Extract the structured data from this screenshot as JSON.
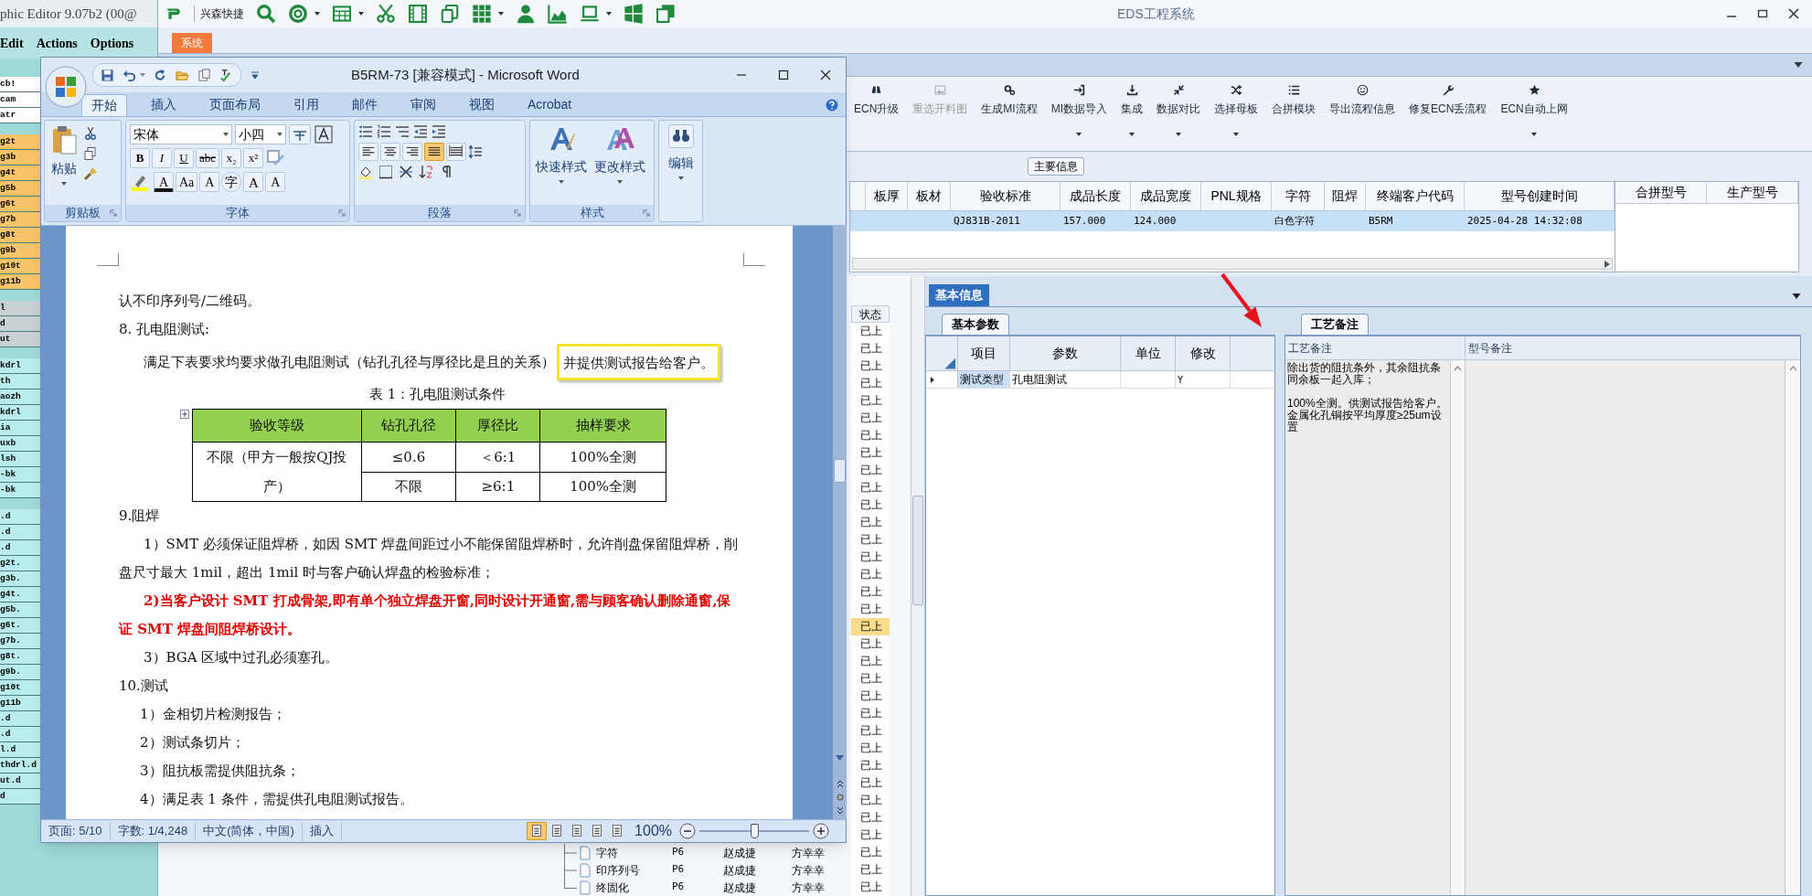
{
  "editor_app": {
    "title": "phic Editor 9.07b2 (00@",
    "menu": [
      "Edit",
      "Actions",
      "Options"
    ],
    "list_groups": [
      {
        "color": "#ffffff",
        "items": [
          "cb!",
          "cam",
          "atr"
        ]
      },
      {
        "color": "#f7c46a",
        "items": [
          "g2t",
          "g3b",
          "g4t",
          "g5b",
          "g6t",
          "g7b",
          "g8t",
          "g9b",
          "g10t",
          "g11b"
        ]
      },
      {
        "color": "#c8d2d4",
        "items": [
          "l",
          "d",
          "ut"
        ]
      },
      {
        "color": "#b9ecec",
        "items": [
          "kdrl",
          "th",
          "aozh",
          "kdrl",
          "ia",
          "uxb",
          "lsh",
          "-bk",
          "-bk"
        ]
      },
      {
        "color": "#b9ecec",
        "items": [
          ".d",
          ".d",
          ".d",
          "g2t.",
          "g3b.",
          "g4t.",
          "g5b.",
          "g6t.",
          "g7b.",
          "g8t.",
          "g9b.",
          "g10t",
          "g11b",
          ".d",
          ".d",
          "l.d",
          "thdrl.d",
          "ut.d",
          "d"
        ]
      }
    ]
  },
  "eds_window": {
    "title": "EDS工程系统",
    "quick_bar_label": "兴森快捷",
    "menu_tab": "系统",
    "ribbon_buttons": [
      {
        "label": "ECN升级",
        "disabled": false,
        "dropdown": false
      },
      {
        "label": "重选开料图",
        "disabled": true,
        "dropdown": false
      },
      {
        "label": "生成MI流程",
        "disabled": false,
        "dropdown": false
      },
      {
        "label": "MI数据导入",
        "disabled": false,
        "dropdown": true
      },
      {
        "label": "集成",
        "disabled": false,
        "dropdown": true
      },
      {
        "label": "数据对比",
        "disabled": false,
        "dropdown": true
      },
      {
        "label": "选择母板",
        "disabled": false,
        "dropdown": true
      },
      {
        "label": "合拼模块",
        "disabled": false,
        "dropdown": false
      },
      {
        "label": "导出流程信息",
        "disabled": false,
        "dropdown": false
      },
      {
        "label": "修复ECN丢流程",
        "disabled": false,
        "dropdown": false
      },
      {
        "label": "ECN自动上网",
        "disabled": false,
        "dropdown": true
      }
    ],
    "main_info": {
      "label": "主要信息",
      "columns": [
        "板厚",
        "板材",
        "验收标准",
        "成品长度",
        "成品宽度",
        "PNL规格",
        "字符",
        "阻焊",
        "终端客户代码",
        "型号创建时间"
      ],
      "rows": [
        {
          "selected": true,
          "cells": [
            "",
            "",
            "QJ831B-2011",
            "157.000",
            "124.000",
            "",
            "白色字符",
            "",
            "B5RM",
            "2025-04-28 14:32:08"
          ]
        }
      ],
      "side_columns": [
        "合拼型号",
        "生产型号"
      ]
    },
    "status_list": {
      "header": "状态",
      "rows": [
        {
          "text": "已上",
          "selected": false
        },
        {
          "text": "已上",
          "selected": false
        },
        {
          "text": "已上",
          "selected": false
        },
        {
          "text": "已上",
          "selected": false
        },
        {
          "text": "已上",
          "selected": false
        },
        {
          "text": "已上",
          "selected": false
        },
        {
          "text": "已上",
          "selected": false
        },
        {
          "text": "已上",
          "selected": false
        },
        {
          "text": "已上",
          "selected": false
        },
        {
          "text": "已上",
          "selected": false
        },
        {
          "text": "已上",
          "selected": false
        },
        {
          "text": "已上",
          "selected": false
        },
        {
          "text": "已上",
          "selected": false
        },
        {
          "text": "已上",
          "selected": false
        },
        {
          "text": "已上",
          "selected": false
        },
        {
          "text": "已上",
          "selected": false
        },
        {
          "text": "已上",
          "selected": false
        },
        {
          "text": "已上",
          "selected": true
        },
        {
          "text": "已上",
          "selected": false
        },
        {
          "text": "已上",
          "selected": false
        },
        {
          "text": "已上",
          "selected": false
        },
        {
          "text": "已上",
          "selected": false
        },
        {
          "text": "已上",
          "selected": false
        },
        {
          "text": "已上",
          "selected": false
        },
        {
          "text": "已上",
          "selected": false
        },
        {
          "text": "已上",
          "selected": false
        },
        {
          "text": "已上",
          "selected": false
        },
        {
          "text": "已上",
          "selected": false
        },
        {
          "text": "已上",
          "selected": false
        },
        {
          "text": "已上",
          "selected": false
        },
        {
          "text": "已上",
          "selected": false
        },
        {
          "text": "已上",
          "selected": false
        },
        {
          "text": "已上",
          "selected": false
        }
      ]
    },
    "tree_rows": [
      {
        "name": "字符",
        "column_2": "P6",
        "column_3": "赵成捷",
        "column_4": "方幸幸"
      },
      {
        "name": "印序列号",
        "column_2": "P6",
        "column_3": "赵成捷",
        "column_4": "方幸幸"
      },
      {
        "name": "终固化",
        "column_2": "P6",
        "column_3": "赵成捷",
        "column_4": "方幸幸"
      }
    ],
    "info_tab": "基本信息",
    "params": {
      "tab": "基本参数",
      "columns": [
        "项目",
        "参数",
        "单位",
        "修改"
      ],
      "rows": [
        {
          "cells": [
            "测试类型",
            "孔电阻测试",
            "",
            "Y"
          ]
        }
      ]
    },
    "notes": {
      "tab": "工艺备注",
      "columns": [
        "工艺备注",
        "型号备注"
      ],
      "text": "除出货的阻抗条外，其余阻抗条同余板一起入库；\n\n100%全测。供测试报告给客户。金属化孔铜按平均厚度≥25um设置"
    }
  },
  "word_window": {
    "title": "B5RM-73 [兼容模式] - Microsoft Word",
    "tabs": [
      {
        "label": "开始",
        "selected": true
      },
      {
        "label": "插入",
        "selected": false
      },
      {
        "label": "页面布局",
        "selected": false
      },
      {
        "label": "引用",
        "selected": false
      },
      {
        "label": "邮件",
        "selected": false
      },
      {
        "label": "审阅",
        "selected": false
      },
      {
        "label": "视图",
        "selected": false
      },
      {
        "label": "Acrobat",
        "selected": false
      }
    ],
    "ribbon": {
      "groups": [
        "剪贴板",
        "字体",
        "段落",
        "样式"
      ],
      "paste": "粘贴",
      "font_name": "宋体",
      "font_size": "小四",
      "format_buttons": [
        "B",
        "I",
        "U",
        "abc",
        "x₂",
        "x²"
      ],
      "font_buttons": [
        {
          "kind": "color",
          "label": "A"
        },
        {
          "kind": "case",
          "label": "Aa"
        },
        {
          "kind": "shade",
          "label": "A"
        },
        {
          "kind": "enclose",
          "label": "字"
        },
        {
          "kind": "grow",
          "label": "A"
        },
        {
          "kind": "shrink",
          "label": "A"
        }
      ],
      "align_buttons": [
        {
          "selected": false
        },
        {
          "selected": false
        },
        {
          "selected": false
        },
        {
          "selected": true
        },
        {
          "selected": false
        }
      ],
      "styles": [
        "快速样式",
        "更改样式"
      ],
      "edit": "编辑"
    },
    "document": [
      {
        "kind": "plain",
        "text": "认不印序列号/二维码。"
      },
      {
        "kind": "plain",
        "text": "8. 孔电阻测试:"
      },
      {
        "kind": "boxed",
        "text": "满足下表要求均要求做孔电阻测试（钻孔孔径与厚径比是且的关系）",
        "boxed_text": "并提供测试报告给客户。"
      },
      {
        "kind": "caption",
        "text": "表 1：孔电阻测试条件"
      },
      {
        "kind": "table",
        "header": [
          "验收等级",
          "钻孔孔径",
          "厚径比",
          "抽样要求"
        ],
        "merged_cell": "不限（甲方一般按QJ投产）",
        "rows": [
          [
            "≤0.6",
            "＜6:1",
            "100%全测"
          ],
          [
            "不限",
            "≥6:1",
            "100%全测"
          ]
        ]
      },
      {
        "kind": "plain",
        "text": "9.阻焊"
      },
      {
        "kind": "indent",
        "text": "1）SMT 必须保证阻焊桥，如因 SMT 焊盘间距过小不能保留阻焊桥时，允许削盘保留阻焊桥，削盘尺寸最大 1mil，超出 1mil 时与客户确认焊盘的检验标准；"
      },
      {
        "kind": "emphasis",
        "text": "2)当客户设计 SMT 打成骨架,即有单个独立焊盘开窗,同时设计开通窗,需与顾客确认删除通窗,保证 SMT 焊盘间阻焊桥设计。"
      },
      {
        "kind": "indent",
        "text": "3）BGA 区域中过孔必须塞孔。"
      },
      {
        "kind": "plain",
        "text": "10.测试"
      },
      {
        "kind": "item",
        "text": "1）金相切片检测报告；"
      },
      {
        "kind": "item",
        "text": "2）测试条切片；"
      },
      {
        "kind": "item",
        "text": "3）阻抗板需提供阻抗条；"
      },
      {
        "kind": "item",
        "text": "4）满足表 1 条件，需提供孔电阻测试报告。"
      }
    ],
    "status_bar": {
      "page": "页面: 5/10",
      "words": "字数: 1/4,248",
      "language": "中文(简体，中国)",
      "mode": "插入",
      "zoom": "100%",
      "view_buttons": [
        {
          "selected": true
        },
        {
          "selected": false
        },
        {
          "selected": false
        },
        {
          "selected": false
        },
        {
          "selected": false
        }
      ],
      "zoom_slider": {
        "level": 0.5
      }
    }
  }
}
